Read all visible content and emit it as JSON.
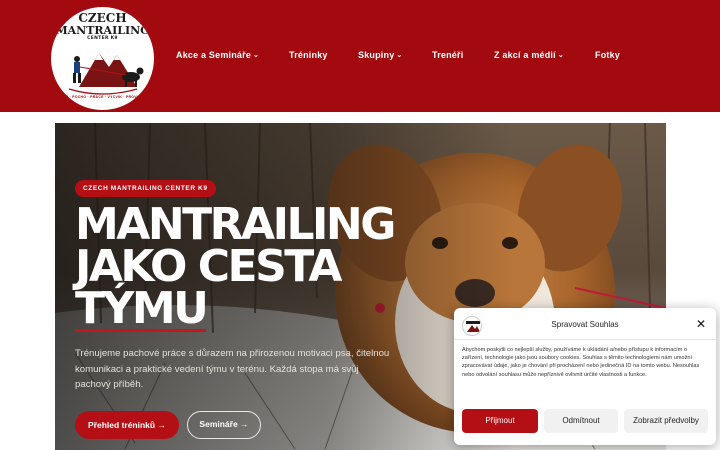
{
  "header": {
    "logo": {
      "title_line1": "CZECH",
      "title_line2": "MANTRAILING",
      "title_line3": "CENTER K9",
      "tagline": "STOPAŘ · POCHO · PRÁCE · VÝCVIK · PROVOZNÍ K9"
    },
    "nav": [
      {
        "label": "Akce a Semináře",
        "has_dropdown": true
      },
      {
        "label": "Tréninky",
        "has_dropdown": false
      },
      {
        "label": "Skupiny",
        "has_dropdown": true
      },
      {
        "label": "Trenéři",
        "has_dropdown": false
      },
      {
        "label": "Z akcí a médií",
        "has_dropdown": true
      },
      {
        "label": "Fotky",
        "has_dropdown": false
      }
    ],
    "chevron": "⌄"
  },
  "hero": {
    "badge": "CZECH MANTRAILING CENTER K9",
    "headline_line1": "MANTRAILING",
    "headline_line2": "JAKO CESTA",
    "headline_line3": "TÝMU",
    "lead": "Trénujeme pachové práce s důrazem na přirozenou motivaci psa, čitelnou komunikaci a praktické vedení týmu v terénu. Každá stopa má svůj pachový příběh.",
    "primary_button": "Přehled tréninků →",
    "secondary_button": "Semináře →"
  },
  "consent": {
    "title": "Spravovat Souhlas",
    "close": "✕",
    "text": "Abychom poskytli co nejlepší služby, používáme k ukládání a/nebo přístupu k informacím o zařízení, technologie jako jsou soubory cookies. Souhlas s těmito technologiemi nám umožní zpracovávat údaje, jako je chování při procházení nebo jedinečná ID na tomto webu. Nesouhlas nebo odvolání souhlasu může nepříznivě ovlivnit určité vlastnosti a funkce.",
    "accept": "Přijmout",
    "deny": "Odmítnout",
    "preferences": "Zobrazit předvolby"
  },
  "colors": {
    "brand_red": "#a30a0f",
    "accent_red": "#b30f15"
  }
}
